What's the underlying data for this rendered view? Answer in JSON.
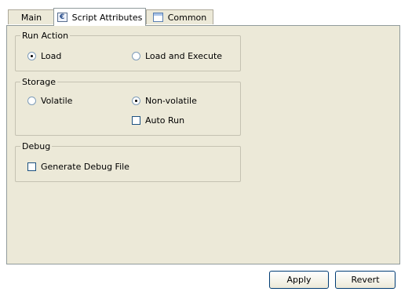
{
  "tabs": [
    {
      "label": "Main"
    },
    {
      "label": "Script Attributes",
      "icon": "script-icon"
    },
    {
      "label": "Common",
      "icon": "common-icon"
    }
  ],
  "groups": {
    "run_action": {
      "title": "Run Action",
      "options": [
        {
          "label": "Load",
          "selected": true
        },
        {
          "label": "Load and Execute",
          "selected": false
        }
      ]
    },
    "storage": {
      "title": "Storage",
      "options": [
        {
          "label": "Volatile",
          "selected": false
        },
        {
          "label": "Non-volatile",
          "selected": true
        }
      ],
      "auto_run": {
        "label": "Auto Run",
        "checked": false
      }
    },
    "debug": {
      "title": "Debug",
      "generate_debug_file": {
        "label": "Generate Debug File",
        "checked": false
      }
    }
  },
  "buttons": {
    "apply": "Apply",
    "revert": "Revert"
  }
}
